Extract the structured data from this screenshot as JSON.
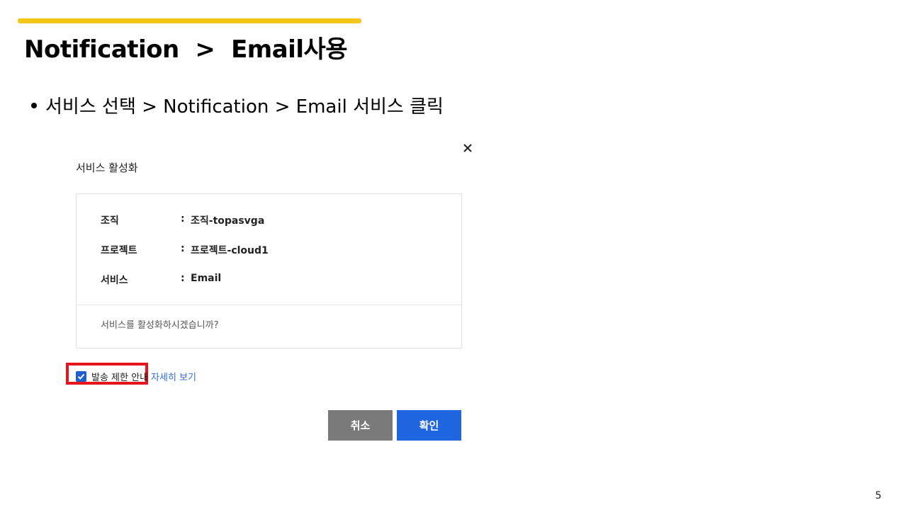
{
  "slide": {
    "title": "Notification  >  Email사용",
    "bullet": "서비스 선택 > Notification > Email 서비스 클릭",
    "page_number": "5"
  },
  "dialog": {
    "title": "서비스 활성화",
    "rows": [
      {
        "label": "조직",
        "value": "조직-topasvga"
      },
      {
        "label": "프로젝트",
        "value": "프로젝트-cloud1"
      },
      {
        "label": "서비스",
        "value": "Email"
      }
    ],
    "colon": ":",
    "question": "서비스를 활성화하시겠습니까?",
    "checkbox": {
      "label": "발송 제한 안내",
      "checked": true
    },
    "detail_link": "자세히 보기",
    "cancel_label": "취소",
    "confirm_label": "확인"
  },
  "colors": {
    "accent_bar": "#f5c518",
    "link": "#2f6fd6",
    "checkbox": "#1f5fd0",
    "cancel_button": "#7a7a7a",
    "confirm_button": "#1f66e0",
    "highlight": "#e8141b"
  },
  "icons": {
    "close": "close-icon",
    "check": "check-icon"
  }
}
